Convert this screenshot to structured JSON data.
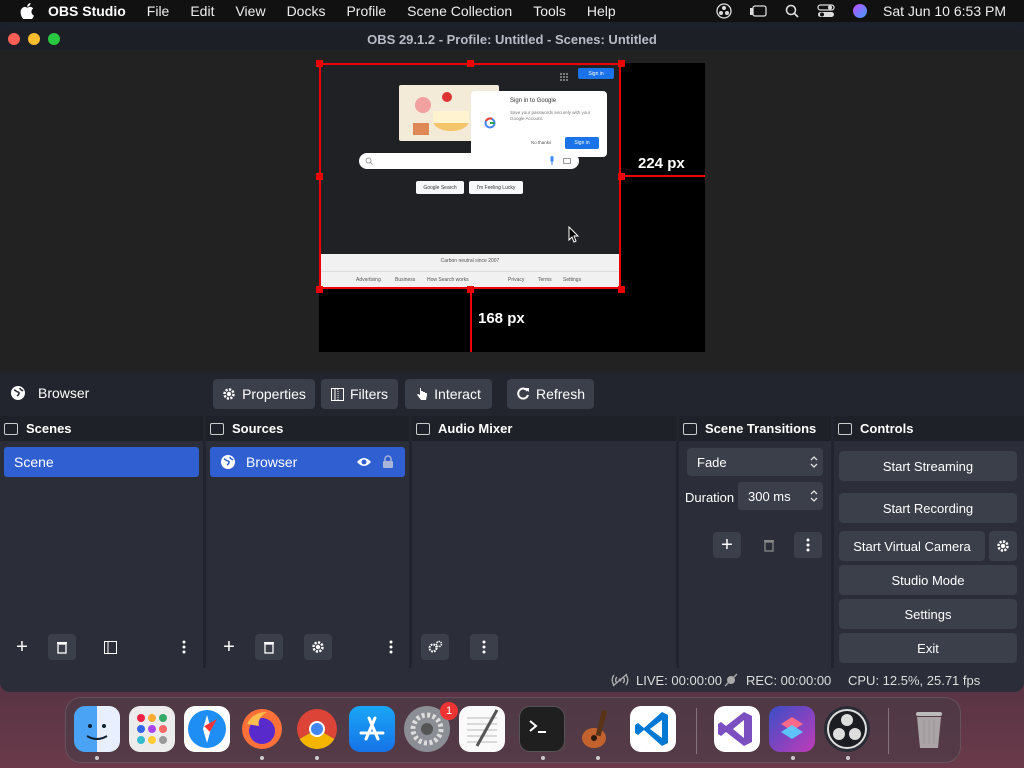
{
  "menubar": {
    "app_name": "OBS Studio",
    "items": [
      "File",
      "Edit",
      "View",
      "Docks",
      "Profile",
      "Scene Collection",
      "Tools",
      "Help"
    ],
    "clock": "Sat Jun 10  6:53 PM"
  },
  "window": {
    "title": "OBS 29.1.2 - Profile: Untitled - Scenes: Untitled"
  },
  "preview": {
    "width_label": "224 px",
    "height_label": "168 px",
    "google": {
      "signin_title": "Sign in to Google",
      "signin_text": "Save your passwords securely with your Google Account.",
      "no_thanks": "No thanks",
      "sign_in": "Sign in",
      "top_sign_in": "Sign in",
      "btn_search": "Google Search",
      "btn_lucky": "I'm Feeling Lucky",
      "carbon": "Carbon neutral since 2007",
      "footer_left": [
        "Advertising",
        "Business",
        "How Search works"
      ],
      "footer_right": [
        "Privacy",
        "Terms",
        "Settings"
      ]
    }
  },
  "source_toolbar": {
    "selected": "Browser",
    "properties": "Properties",
    "filters": "Filters",
    "interact": "Interact",
    "refresh": "Refresh"
  },
  "docks": {
    "scenes": {
      "title": "Scenes",
      "items": [
        "Scene"
      ]
    },
    "sources": {
      "title": "Sources",
      "items": [
        "Browser"
      ]
    },
    "audio": {
      "title": "Audio Mixer"
    },
    "transitions": {
      "title": "Scene Transitions",
      "type": "Fade",
      "duration_label": "Duration",
      "duration": "300 ms"
    },
    "controls": {
      "title": "Controls",
      "start_streaming": "Start Streaming",
      "start_recording": "Start Recording",
      "virtual_camera": "Start Virtual Camera",
      "studio_mode": "Studio Mode",
      "settings": "Settings",
      "exit": "Exit"
    }
  },
  "status": {
    "live": "LIVE: 00:00:00",
    "rec": "REC: 00:00:00",
    "cpu": "CPU: 12.5%, 25.71 fps"
  },
  "dock_apps": [
    "finder",
    "launchpad",
    "safari",
    "firefox",
    "chrome",
    "app-store",
    "system-settings",
    "textedit",
    "terminal",
    "garageband",
    "vscode",
    "visual-studio",
    "shortcuts",
    "obs",
    "trash"
  ],
  "badges": {
    "system_settings": "1"
  },
  "colors": {
    "accent": "#2f5fd0",
    "selection": "#e00000"
  }
}
